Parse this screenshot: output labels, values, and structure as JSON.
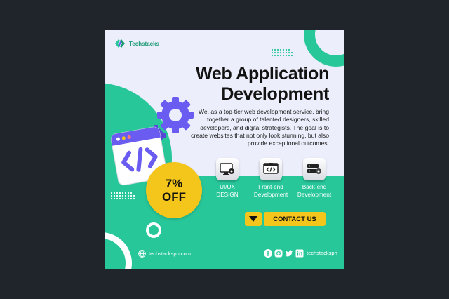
{
  "brand": {
    "name": "Techstacks"
  },
  "headline": {
    "line1": "Web Application",
    "line2": "Development"
  },
  "description": "We, as a top-tier web development service, bring together a group of talented designers, skilled developers, and digital strategists. The goal is to create websites that not only look stunning, but also provide exceptional outcomes.",
  "promo": {
    "percent": "7%",
    "word": "OFF"
  },
  "services": [
    {
      "line1": "UI/UX",
      "line2": "DESIGN",
      "icon": "monitor-gear-icon"
    },
    {
      "line1": "Front-end",
      "line2": "Development",
      "icon": "code-window-icon"
    },
    {
      "line1": "Back-end",
      "line2": "Development",
      "icon": "server-gear-icon"
    }
  ],
  "cta": {
    "label": "CONTACT US",
    "icon": "triangle-down-icon"
  },
  "footer": {
    "website": "techstacksph.com",
    "handle": "techstacksph"
  },
  "colors": {
    "green": "#27c79a",
    "yellow": "#f4c51b",
    "purple": "#6a5cf0",
    "background": "#20252c"
  }
}
